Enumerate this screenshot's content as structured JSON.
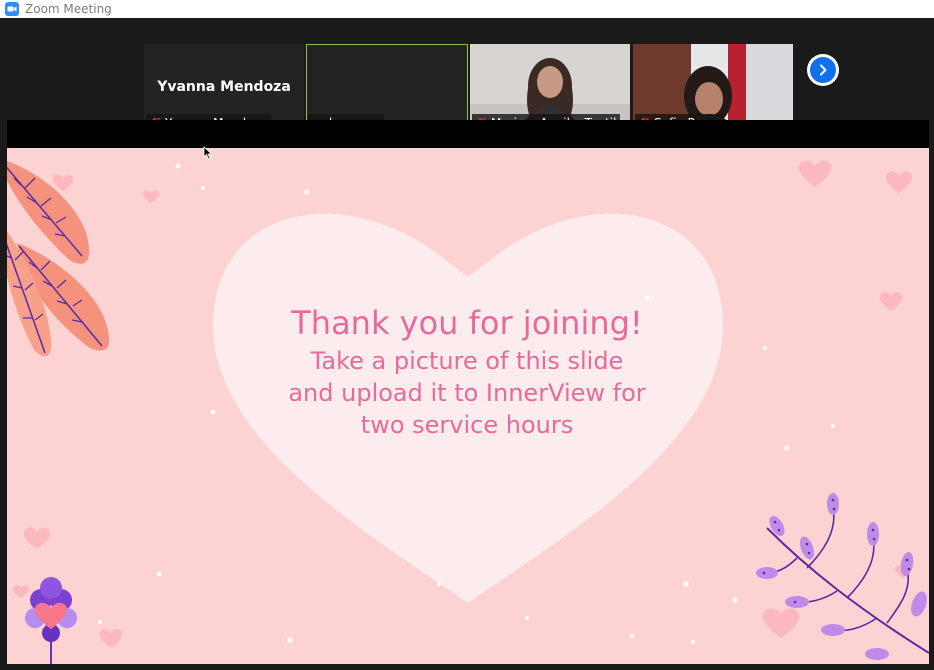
{
  "window": {
    "title": "Zoom Meeting"
  },
  "participants": [
    {
      "name": "Yvanna Mendoza",
      "label": "Yvanna Mendoza",
      "video": false,
      "muted": true
    },
    {
      "name": "carla nunez",
      "label": "carla nunez",
      "video": false,
      "muted": false,
      "active_speaker": true
    },
    {
      "name": "Mariam Aguilar-Tantil",
      "label": "Mariam Aguilar-Tantil",
      "video": true,
      "muted": true
    },
    {
      "name": "Sofia Perez",
      "label": "Sofia Perez",
      "video": true,
      "muted": true
    }
  ],
  "slide": {
    "heading": "Thank you for joining!",
    "body": "Take a picture of this slide and upload it to InnerView for two service hours"
  },
  "colors": {
    "slide_background": "#fcd2d3",
    "heart": "#fdeced",
    "text_pink": "#e66a9c",
    "zoom_blue": "#0e71eb",
    "muted_red": "#e02828",
    "active_speaker_border": "#8bc34a"
  },
  "icons": {
    "app": "zoom-camera-icon",
    "muted": "muted-mic-icon",
    "next": "chevron-right-icon"
  }
}
